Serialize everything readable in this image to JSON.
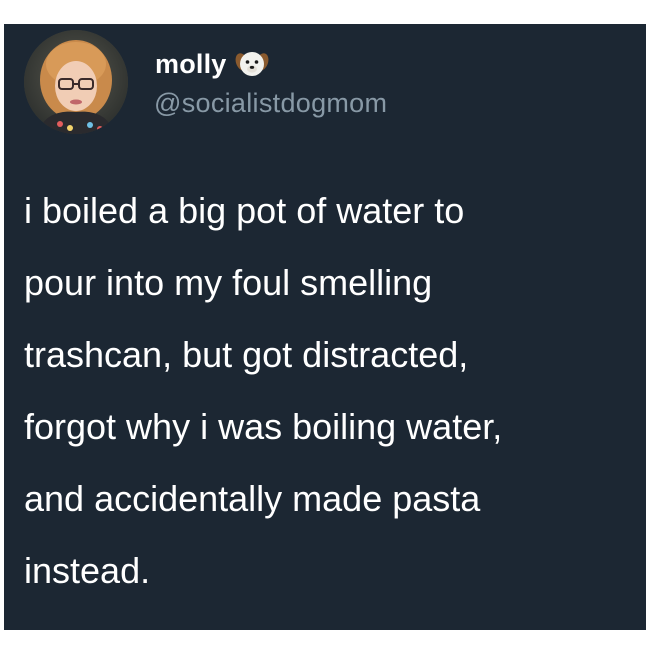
{
  "tweet": {
    "author": {
      "display_name": "molly",
      "handle": "@socialistdogmom",
      "name_emoji": "dog-face-icon",
      "avatar": "profile-photo-avatar"
    },
    "text_lines": [
      "i boiled a big pot of water to",
      "pour into my foul smelling",
      "trashcan, but got distracted,",
      "forgot why i was boiling water,",
      "and accidentally made pasta",
      "instead."
    ]
  },
  "colors": {
    "card_background": "#1c2733",
    "page_background": "#ffffff",
    "primary_text": "#ffffff",
    "secondary_text": "#8899a6"
  }
}
